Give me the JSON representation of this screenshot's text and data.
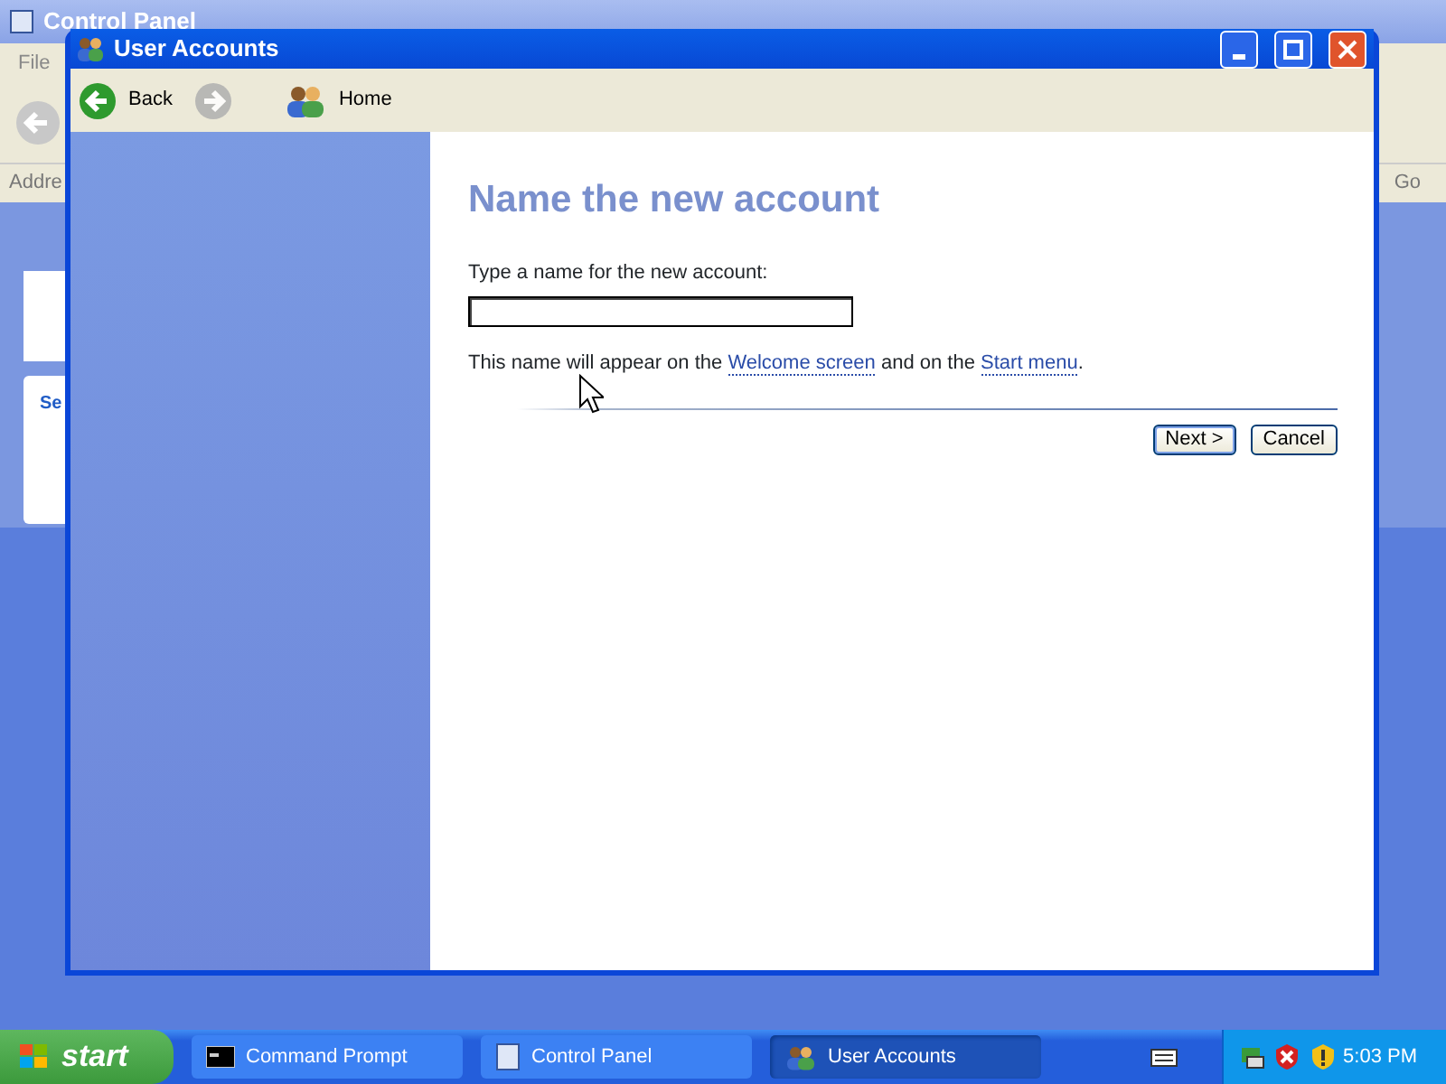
{
  "back_window": {
    "title": "Control Panel",
    "menu": [
      "File"
    ],
    "address_label": "Addre",
    "go": "Go",
    "task_heading": "Se"
  },
  "window": {
    "title": "User Accounts"
  },
  "toolbar": [
    {
      "kind": "back",
      "label": "Back",
      "disabled": false
    },
    {
      "kind": "forward",
      "disabled": true
    },
    {
      "kind": "home",
      "label": "Home",
      "disabled": false
    }
  ],
  "page": {
    "heading": "Name the new account",
    "field_label": "Type a name for the new account:",
    "note": [
      {
        "kind": "text",
        "text": "This name will appear on the "
      },
      {
        "kind": "link",
        "text": "Welcome screen"
      },
      {
        "kind": "text",
        "text": " and on the "
      },
      {
        "kind": "link",
        "text": "Start menu"
      },
      {
        "kind": "text",
        "text": "."
      }
    ],
    "buttons": [
      {
        "label": "Next >",
        "default": true
      },
      {
        "label": "Cancel",
        "default": false
      }
    ]
  },
  "taskbar": {
    "start": "start",
    "tasks": [
      {
        "kind": "console",
        "label": "Command Prompt",
        "selected": false
      },
      {
        "kind": "panel",
        "label": "Control Panel",
        "selected": false
      },
      {
        "kind": "users",
        "label": "User Accounts",
        "selected": true
      }
    ],
    "clock": "5:03 PM"
  }
}
